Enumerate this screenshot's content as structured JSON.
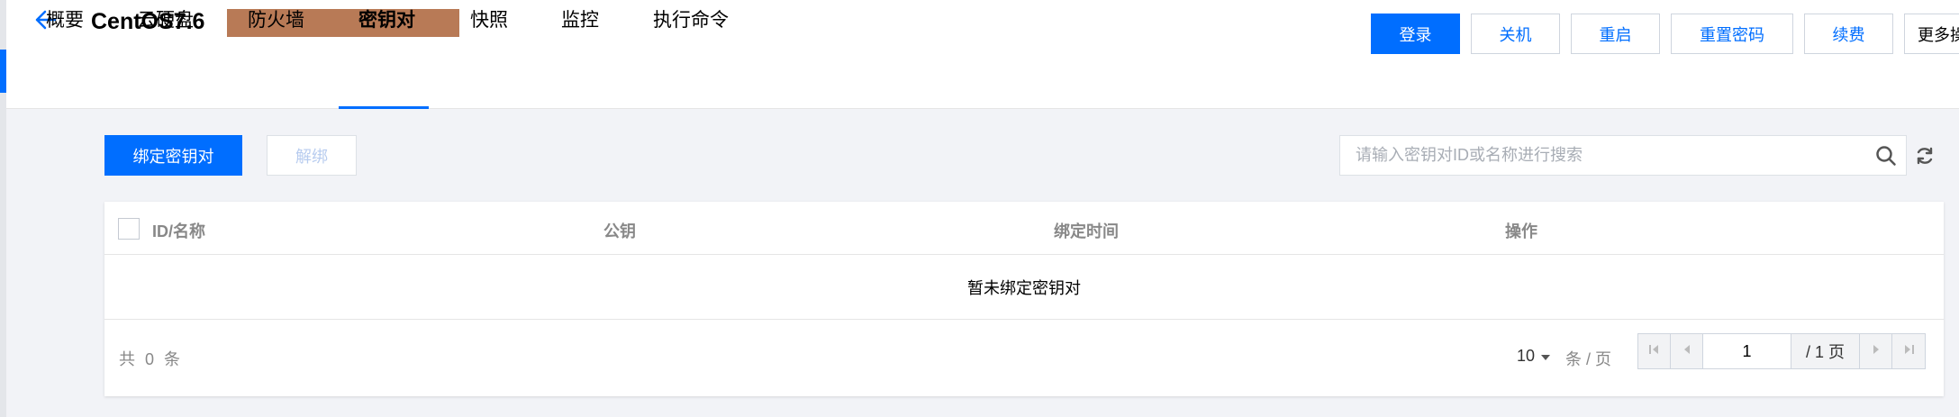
{
  "header": {
    "title": "CentOS7.6",
    "actions": [
      {
        "label": "登录",
        "primary": true
      },
      {
        "label": "关机"
      },
      {
        "label": "重启"
      },
      {
        "label": "重置密码"
      },
      {
        "label": "续费"
      },
      {
        "label": "更多操"
      }
    ]
  },
  "tabs": [
    {
      "label": "概要"
    },
    {
      "label": "云硬盘"
    },
    {
      "label": "防火墙"
    },
    {
      "label": "密钥对",
      "active": true
    },
    {
      "label": "快照"
    },
    {
      "label": "监控"
    },
    {
      "label": "执行命令"
    }
  ],
  "toolbar": {
    "bind_label": "绑定密钥对",
    "unbind_label": "解绑",
    "search_placeholder": "请输入密钥对ID或名称进行搜索"
  },
  "table": {
    "columns": [
      "ID/名称",
      "公钥",
      "绑定时间",
      "操作"
    ],
    "empty_text": "暂未绑定密钥对"
  },
  "pagination": {
    "total_text": "共 0 条",
    "page_size": "10",
    "page_size_unit": "条 / 页",
    "current_page": "1",
    "total_pages": "/ 1 页"
  },
  "colors": {
    "accent": "#006eff",
    "redaction": "#b87a56"
  },
  "icons": [
    "back-arrow-icon",
    "search-icon",
    "refresh-icon",
    "caret-down-icon",
    "first-page-icon",
    "prev-page-icon",
    "next-page-icon",
    "last-page-icon"
  ]
}
